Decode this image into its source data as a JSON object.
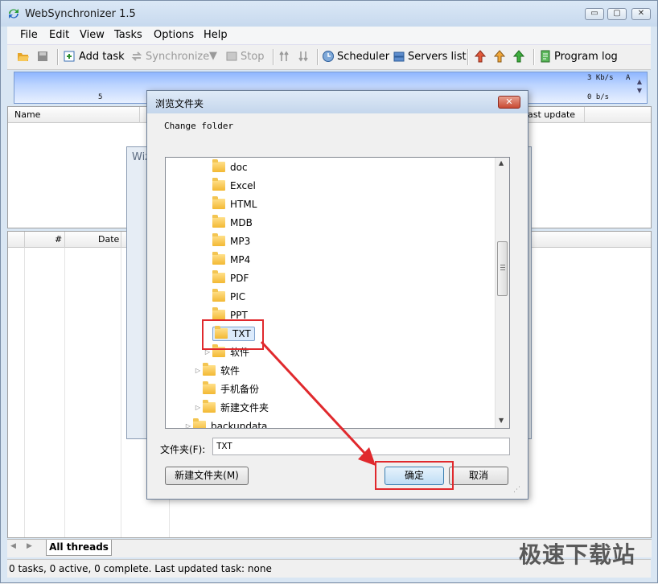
{
  "app": {
    "title": "WebSynchronizer 1.5"
  },
  "window_controls": {
    "minimize": "▭",
    "restore": "▢",
    "close": "✕"
  },
  "menu": [
    "File",
    "Edit",
    "View",
    "Tasks",
    "Options",
    "Help"
  ],
  "toolbar": {
    "add_task": "Add task",
    "synchronize": "Synchronize",
    "stop": "Stop",
    "scheduler": "Scheduler",
    "servers_list": "Servers list",
    "program_log": "Program log"
  },
  "graph": {
    "top_speed": "3 Kb/s",
    "bottom_speed": "0 b/s",
    "scale_left": "5",
    "scale_right": "A"
  },
  "tasks_table": {
    "columns": [
      "Name",
      "ast update"
    ]
  },
  "threads_table": {
    "columns": [
      "#",
      "Date"
    ]
  },
  "wizard": {
    "title_partial": "Wiz"
  },
  "dialog": {
    "title": "浏览文件夹",
    "instruction": "Change folder",
    "folder_label": "文件夹(F):",
    "folder_value": "TXT",
    "new_folder_button": "新建文件夹(M)",
    "ok_button": "确定",
    "cancel_button": "取消",
    "tree": [
      {
        "label": "doc",
        "depth": 2,
        "expandable": false,
        "selected": false
      },
      {
        "label": "Excel",
        "depth": 2,
        "expandable": false,
        "selected": false
      },
      {
        "label": "HTML",
        "depth": 2,
        "expandable": false,
        "selected": false
      },
      {
        "label": "MDB",
        "depth": 2,
        "expandable": false,
        "selected": false
      },
      {
        "label": "MP3",
        "depth": 2,
        "expandable": false,
        "selected": false
      },
      {
        "label": "MP4",
        "depth": 2,
        "expandable": false,
        "selected": false
      },
      {
        "label": "PDF",
        "depth": 2,
        "expandable": false,
        "selected": false
      },
      {
        "label": "PIC",
        "depth": 2,
        "expandable": false,
        "selected": false
      },
      {
        "label": "PPT",
        "depth": 2,
        "expandable": false,
        "selected": false
      },
      {
        "label": "TXT",
        "depth": 2,
        "expandable": false,
        "selected": true
      },
      {
        "label": "软件",
        "depth": 2,
        "expandable": true,
        "selected": false
      },
      {
        "label": "软件",
        "depth": 1,
        "expandable": true,
        "selected": false
      },
      {
        "label": "手机备份",
        "depth": 1,
        "expandable": false,
        "selected": false
      },
      {
        "label": "新建文件夹",
        "depth": 1,
        "expandable": true,
        "selected": false
      },
      {
        "label": "backupdata",
        "depth": 0,
        "expandable": true,
        "selected": false
      }
    ]
  },
  "tabs": {
    "all_threads": "All threads"
  },
  "status": {
    "text": "0 tasks, 0 active, 0 complete. Last updated task: none"
  },
  "watermark": "极速下载站",
  "colors": {
    "highlight_red": "#e0292d",
    "graph_blue": "#8fb6ff"
  }
}
